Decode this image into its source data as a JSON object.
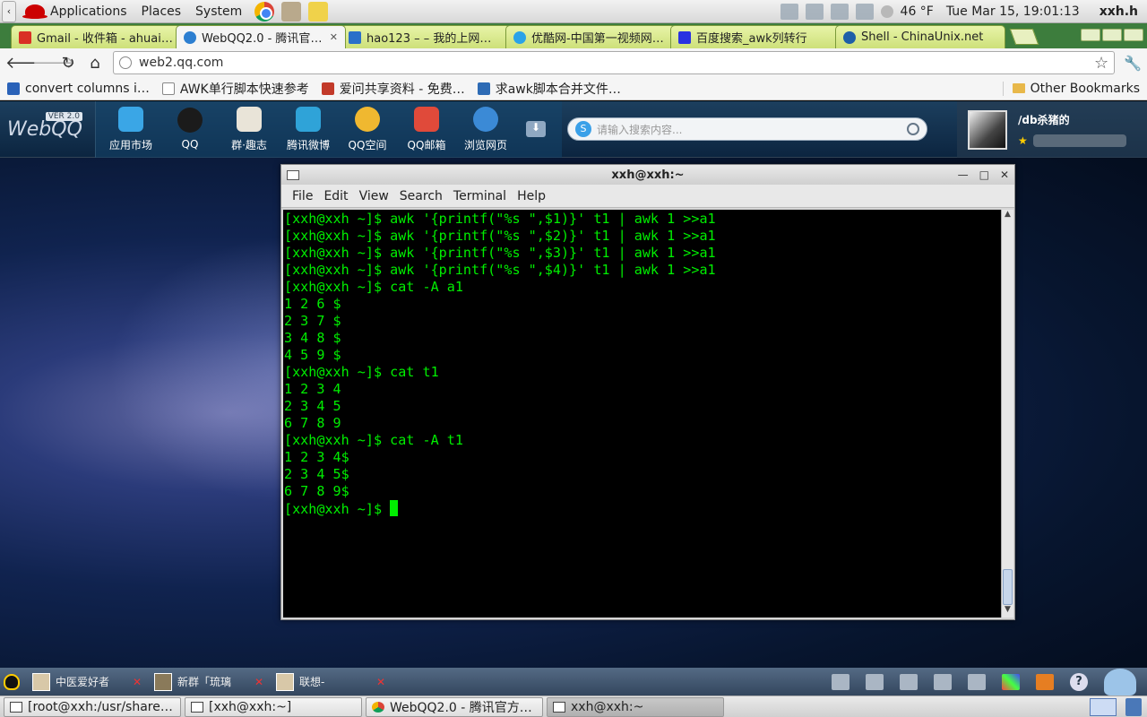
{
  "top_panel": {
    "menus": [
      "Applications",
      "Places",
      "System"
    ],
    "weather": "46 °F",
    "datetime": "Tue Mar 15, 19:01:13",
    "user": "xxh.h"
  },
  "browser": {
    "tabs": [
      {
        "title": "Gmail - 收件箱 - ahuai…",
        "color": "#d93025"
      },
      {
        "title": "WebQQ2.0 - 腾讯官方…",
        "color": "#2d7fd1",
        "active": true
      },
      {
        "title": "hao123 – – 我的上网…",
        "color": "#2a6fc9"
      },
      {
        "title": "优酷网-中国第一视频网…",
        "color": "#2aa3e8"
      },
      {
        "title": "百度搜索_awk列转行",
        "color": "#2932e1"
      },
      {
        "title": "Shell - ChinaUnix.net",
        "color": "#1e5fa8"
      }
    ],
    "url": "web2.qq.com",
    "bookmarks": [
      {
        "label": "convert columns i…",
        "color": "#2a62b8"
      },
      {
        "label": "AWK单行脚本快速参考",
        "color": "#ffffff"
      },
      {
        "label": "爱问共享资料 - 免费…",
        "color": "#c23a2a"
      },
      {
        "label": "求awk脚本合并文件…",
        "color": "#2d6bb5"
      }
    ],
    "other_bookmarks": "Other Bookmarks"
  },
  "webqq": {
    "logo": "WebQQ",
    "version": "VER 2.0",
    "apps": [
      {
        "label": "应用市场",
        "color": "#3aa6e6"
      },
      {
        "label": "QQ",
        "color": "#1b1b1b"
      },
      {
        "label": "群·趣志",
        "color": "#e9e4d8"
      },
      {
        "label": "腾讯微博",
        "color": "#2fa3d8"
      },
      {
        "label": "QQ空间",
        "color": "#f0b830"
      },
      {
        "label": "QQ邮箱",
        "color": "#e04a3a"
      },
      {
        "label": "浏览网页",
        "color": "#3b8ad6"
      }
    ],
    "search_placeholder": "请输入搜索内容...",
    "username": "/db杀猪的",
    "chats": [
      "中医爱好者",
      "新群「琉璃",
      "联想-"
    ]
  },
  "terminal": {
    "title": "xxh@xxh:~",
    "menu": [
      "File",
      "Edit",
      "View",
      "Search",
      "Terminal",
      "Help"
    ],
    "lines": [
      "[xxh@xxh ~]$ awk '{printf(\"%s \",$1)}' t1 | awk 1 >>a1",
      "[xxh@xxh ~]$ awk '{printf(\"%s \",$2)}' t1 | awk 1 >>a1",
      "[xxh@xxh ~]$ awk '{printf(\"%s \",$3)}' t1 | awk 1 >>a1",
      "[xxh@xxh ~]$ awk '{printf(\"%s \",$4)}' t1 | awk 1 >>a1",
      "[xxh@xxh ~]$ cat -A a1",
      "1 2 6 $",
      "2 3 7 $",
      "3 4 8 $",
      "4 5 9 $",
      "[xxh@xxh ~]$ cat t1",
      "1 2 3 4",
      "2 3 4 5",
      "6 7 8 9",
      "[xxh@xxh ~]$ cat -A t1",
      "1 2 3 4$",
      "2 3 4 5$",
      "6 7 8 9$"
    ],
    "prompt": "[xxh@xxh ~]$ "
  },
  "taskbar": [
    {
      "label": "[root@xxh:/usr/share/…",
      "icon": "terminal-icon"
    },
    {
      "label": "[xxh@xxh:~]",
      "icon": "terminal-icon"
    },
    {
      "label": "WebQQ2.0 - 腾讯官方…",
      "icon": "chrome-icon"
    },
    {
      "label": "xxh@xxh:~",
      "icon": "terminal-icon",
      "active": true
    }
  ]
}
